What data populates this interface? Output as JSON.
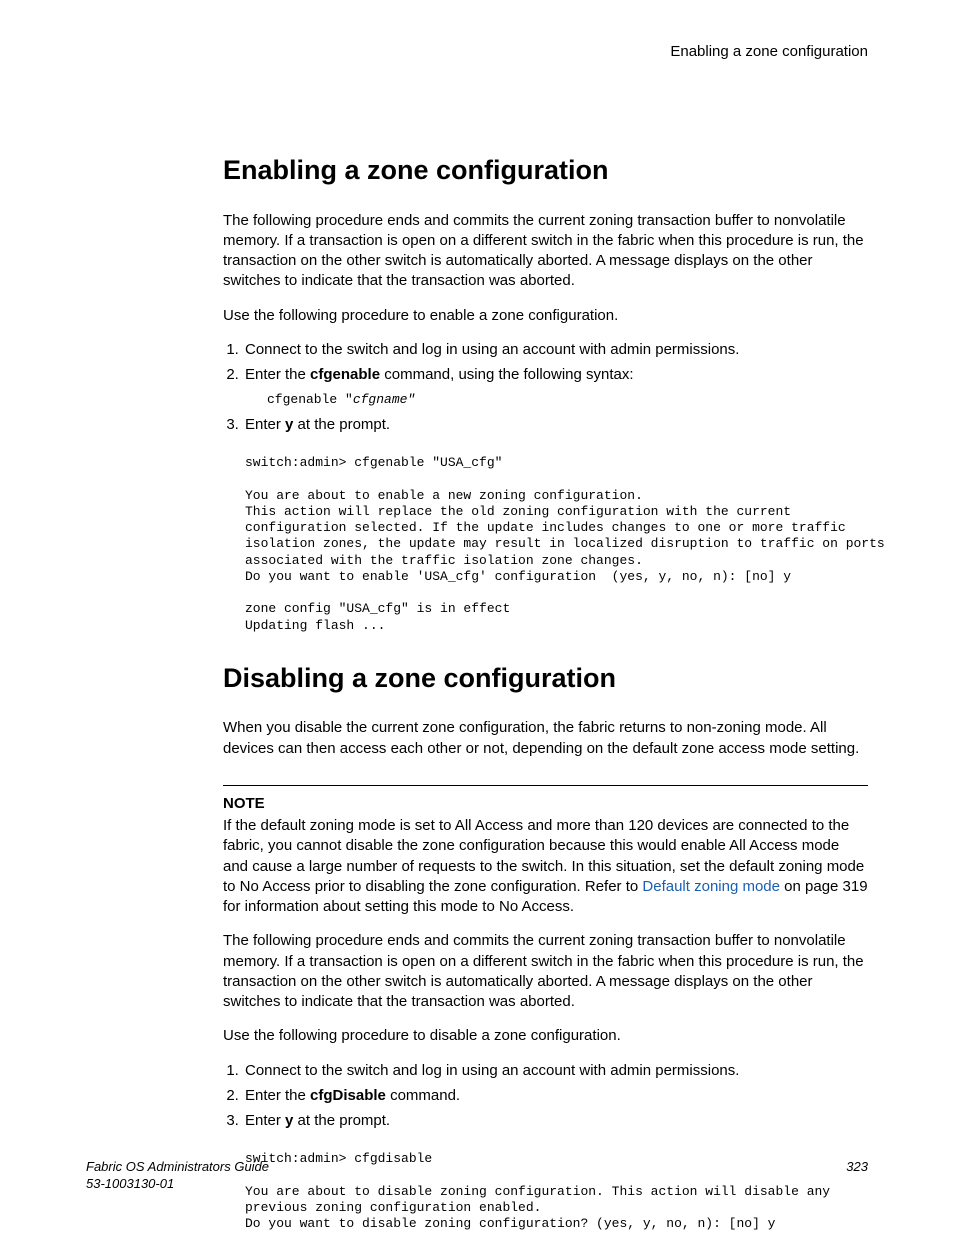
{
  "running_head": "Enabling a zone configuration",
  "section1": {
    "title": "Enabling a zone configuration",
    "para1": "The following procedure ends and commits the current zoning transaction buffer to nonvolatile memory. If a transaction is open on a different switch in the fabric when this procedure is run, the transaction on the other switch is automatically aborted. A message displays on the other switches to indicate that the transaction was aborted.",
    "para2": "Use the following procedure to enable a zone configuration.",
    "steps": {
      "s1": "Connect to the switch and log in using an account with admin permissions.",
      "s2a": "Enter the ",
      "s2b": "cfgenable",
      "s2c": " command, using the following syntax:",
      "cmd_prefix": "cfgenable \"",
      "cmd_arg": "cfgname\"",
      "s3a": "Enter ",
      "s3b": "y",
      "s3c": " at the prompt."
    },
    "terminal": "switch:admin> cfgenable \"USA_cfg\"\n\nYou are about to enable a new zoning configuration.\nThis action will replace the old zoning configuration with the current\nconfiguration selected. If the update includes changes to one or more traffic\nisolation zones, the update may result in localized disruption to traffic on ports\nassociated with the traffic isolation zone changes.\nDo you want to enable 'USA_cfg' configuration  (yes, y, no, n): [no] y\n\nzone config \"USA_cfg\" is in effect\nUpdating flash ..."
  },
  "section2": {
    "title": "Disabling a zone configuration",
    "para1": "When you disable the current zone configuration, the fabric returns to non-zoning mode. All devices can then access each other or not, depending on the default zone access mode setting.",
    "note_label": "NOTE",
    "note_a": "If the default zoning mode is set to All Access and more than 120 devices are connected to the fabric, you cannot disable the zone configuration because this would enable All Access mode and cause a large number of requests to the switch. In this situation, set the default zoning mode to No Access prior to disabling the zone configuration. Refer to ",
    "note_link": "Default zoning mode",
    "note_b": " on page 319 for information about setting this mode to No Access.",
    "para2": "The following procedure ends and commits the current zoning transaction buffer to nonvolatile memory. If a transaction is open on a different switch in the fabric when this procedure is run, the transaction on the other switch is automatically aborted. A message displays on the other switches to indicate that the transaction was aborted.",
    "para3": "Use the following procedure to disable a zone configuration.",
    "steps": {
      "s1": "Connect to the switch and log in using an account with admin permissions.",
      "s2a": "Enter the ",
      "s2b": "cfgDisable",
      "s2c": " command.",
      "s3a": "Enter ",
      "s3b": "y",
      "s3c": " at the prompt."
    },
    "terminal": "switch:admin> cfgdisable\n\nYou are about to disable zoning configuration. This action will disable any\nprevious zoning configuration enabled.\nDo you want to disable zoning configuration? (yes, y, no, n): [no] y"
  },
  "footer": {
    "title": "Fabric OS Administrators Guide",
    "docnum": "53-1003130-01",
    "page": "323"
  }
}
